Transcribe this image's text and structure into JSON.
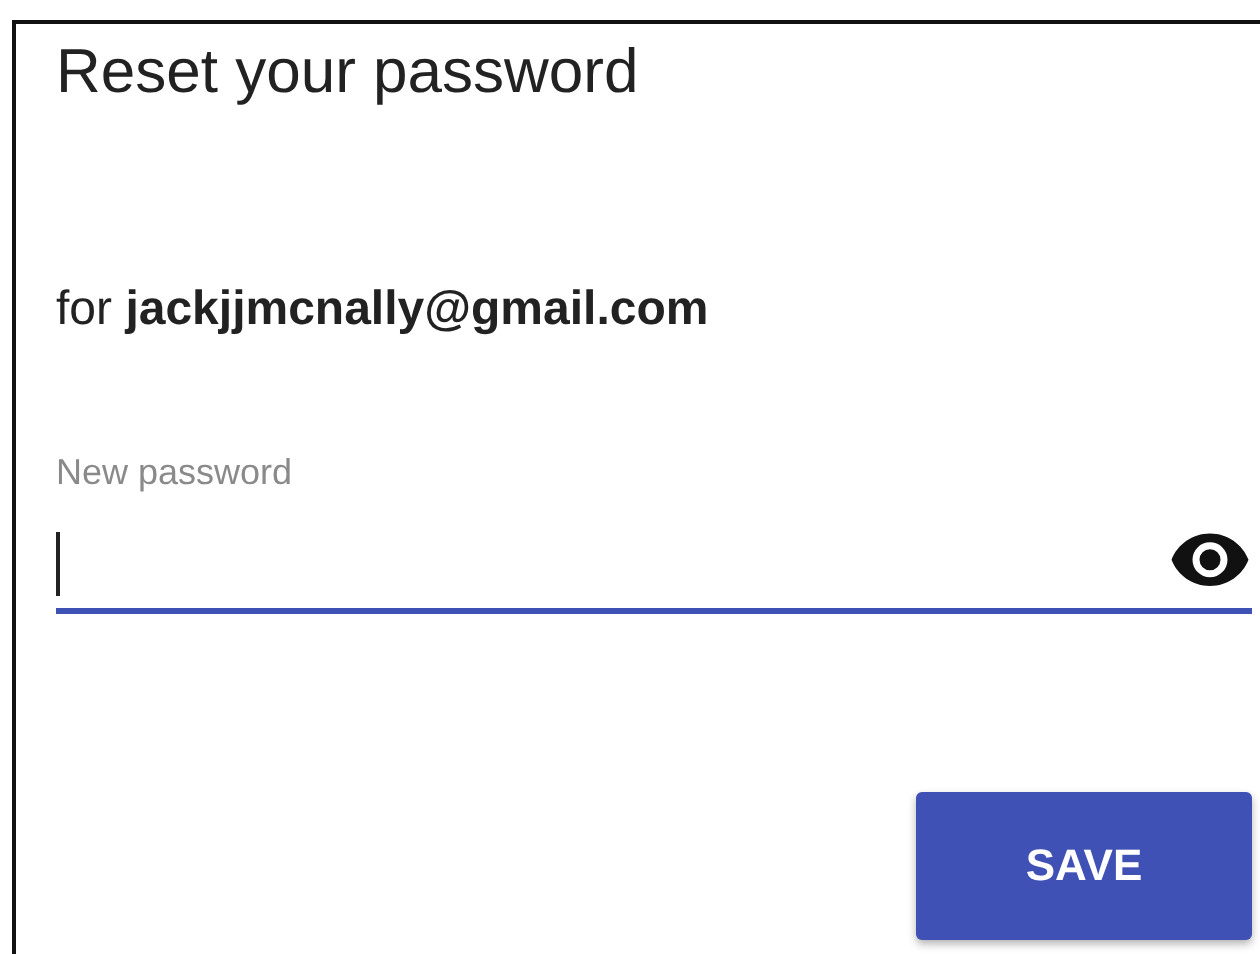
{
  "dialog": {
    "title": "Reset your password",
    "subtitle": "for **jackjjmcnally@gmail.com**",
    "password_field": {
      "label": "New password",
      "focused": true
    },
    "buttons": [
      {
        "label": "SAVE"
      }
    ]
  }
}
